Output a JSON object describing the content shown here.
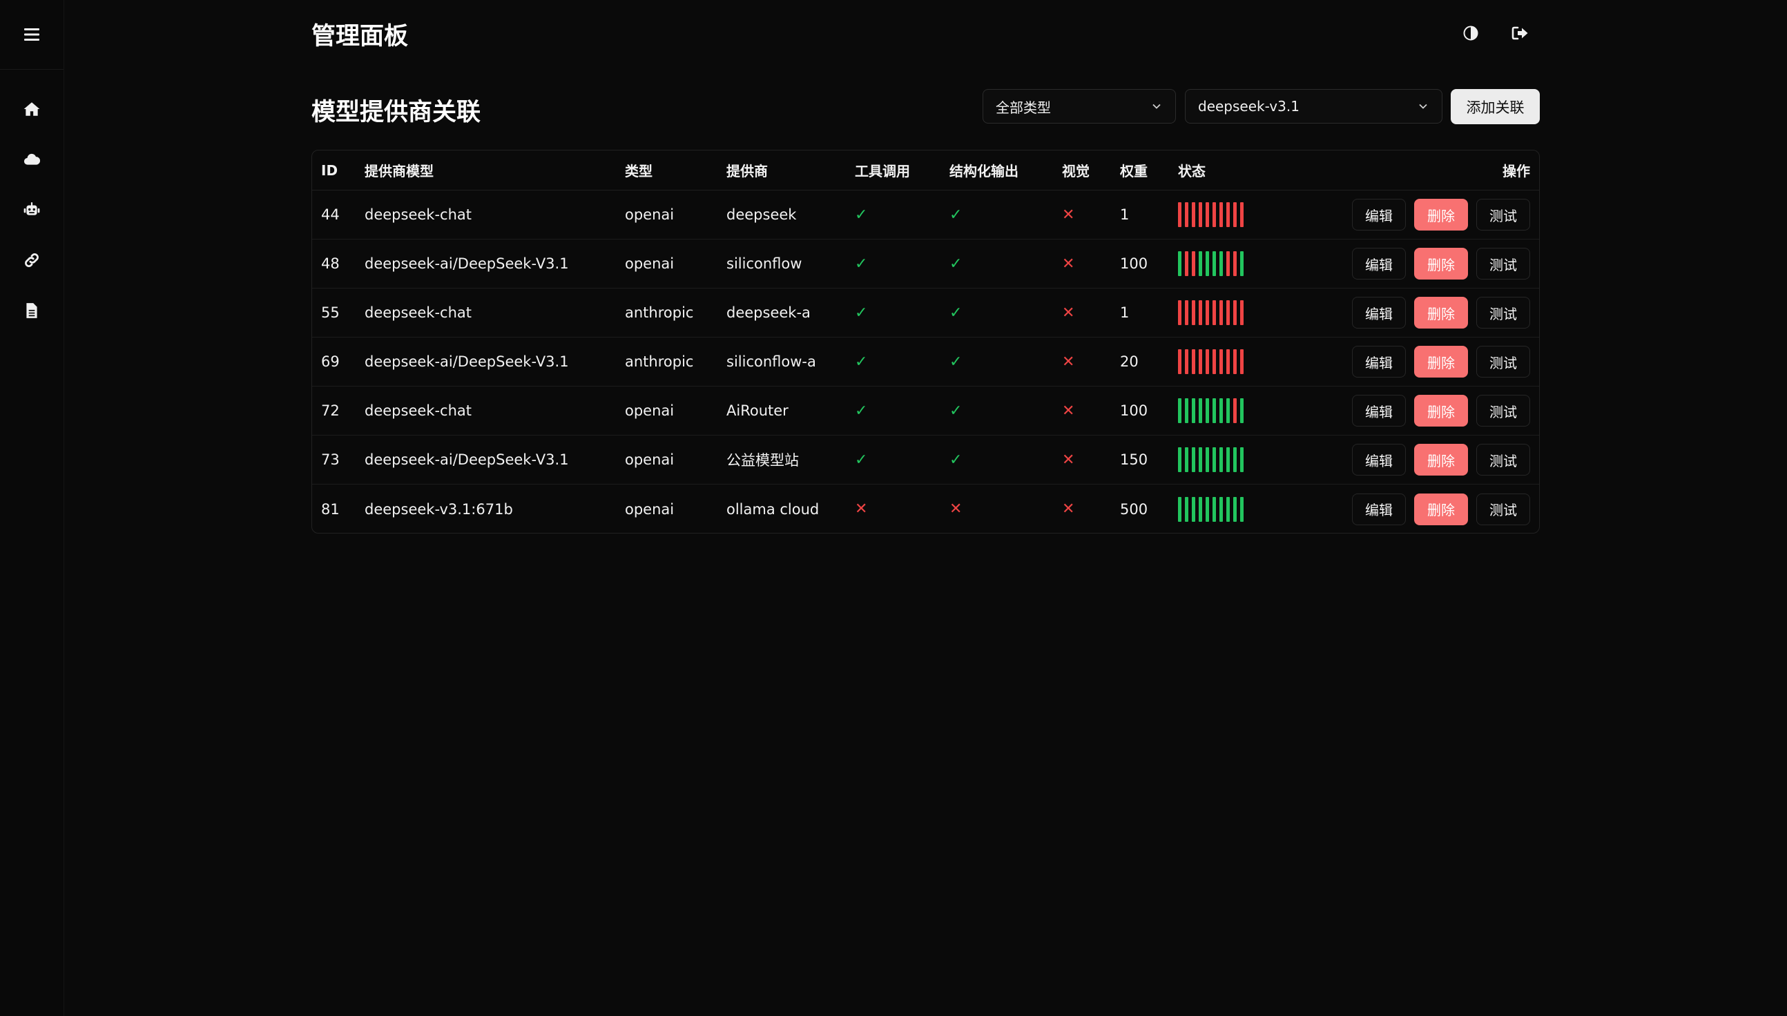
{
  "header": {
    "title": "管理面板"
  },
  "sidebar": {
    "items": [
      "home-icon",
      "cloud-icon",
      "robot-icon",
      "link-icon",
      "document-icon"
    ]
  },
  "page": {
    "title": "模型提供商关联"
  },
  "filters": {
    "type_select": "全部类型",
    "model_select": "deepseek-v3.1",
    "add_button": "添加关联"
  },
  "table": {
    "headers": {
      "id": "ID",
      "model": "提供商模型",
      "type": "类型",
      "provider": "提供商",
      "tool": "工具调用",
      "structured": "结构化输出",
      "vision": "视觉",
      "weight": "权重",
      "status": "状态",
      "actions": "操作"
    },
    "actions": {
      "edit": "编辑",
      "delete": "删除",
      "test": "测试"
    },
    "rows": [
      {
        "id": "44",
        "model": "deepseek-chat",
        "type": "openai",
        "provider": "deepseek",
        "tool": "✓",
        "structured": "✓",
        "vision": "✕",
        "weight": "1",
        "status": "RRRRRRRRRR"
      },
      {
        "id": "48",
        "model": "deepseek-ai/DeepSeek-V3.1",
        "type": "openai",
        "provider": "siliconflow",
        "tool": "✓",
        "structured": "✓",
        "vision": "✕",
        "weight": "100",
        "status": "GRRGGGGRRG"
      },
      {
        "id": "55",
        "model": "deepseek-chat",
        "type": "anthropic",
        "provider": "deepseek-a",
        "tool": "✓",
        "structured": "✓",
        "vision": "✕",
        "weight": "1",
        "status": "RRRRRRRRRR"
      },
      {
        "id": "69",
        "model": "deepseek-ai/DeepSeek-V3.1",
        "type": "anthropic",
        "provider": "siliconflow-a",
        "tool": "✓",
        "structured": "✓",
        "vision": "✕",
        "weight": "20",
        "status": "RRRRRRRRRR"
      },
      {
        "id": "72",
        "model": "deepseek-chat",
        "type": "openai",
        "provider": "AiRouter",
        "tool": "✓",
        "structured": "✓",
        "vision": "✕",
        "weight": "100",
        "status": "GGGGGGGGRG"
      },
      {
        "id": "73",
        "model": "deepseek-ai/DeepSeek-V3.1",
        "type": "openai",
        "provider": "公益模型站",
        "tool": "✓",
        "structured": "✓",
        "vision": "✕",
        "weight": "150",
        "status": "GGGGGGGGGG"
      },
      {
        "id": "81",
        "model": "deepseek-v3.1:671b",
        "type": "openai",
        "provider": "ollama cloud",
        "tool": "✕",
        "structured": "✕",
        "vision": "✕",
        "weight": "500",
        "status": "GGGGGGGGGG"
      }
    ]
  },
  "colors": {
    "ok": "#22c55e",
    "fail": "#ef4444",
    "delete_bg": "#f87171"
  }
}
